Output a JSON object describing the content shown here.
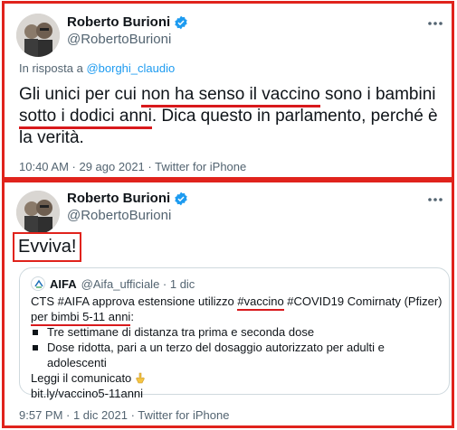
{
  "tweet1": {
    "author_name": "Roberto Burioni",
    "author_handle": "@RobertoBurioni",
    "reply_prefix": "In risposta a",
    "reply_mention": "@borghi_claudio",
    "text_a": "Gli unici per cui ",
    "text_b": "non ha senso il vaccino",
    "text_c": " sono i bambini ",
    "text_d": "sotto i dodici anni",
    "text_e": ". Dica questo in parlamento, perché è la verità.",
    "timestamp": "10:40 AM · 29 ago 2021 · Twitter for iPhone"
  },
  "tweet2": {
    "author_name": "Roberto Burioni",
    "author_handle": "@RobertoBurioni",
    "text": "Evviva!",
    "timestamp": "9:57 PM · 1 dic 2021 · Twitter for iPhone",
    "quote": {
      "name": "AIFA",
      "handle_date": "@Aifa_ufficiale · 1 dic",
      "line1_a": "CTS #AIFA approva estensione utilizzo ",
      "line1_b": "#vaccino",
      "line1_c": " #COVID19 Comirnaty (Pfizer)",
      "line2": "per bimbi 5-11 anni",
      "line2_after": ":",
      "bullet1": "Tre settimane di distanza tra prima e seconda dose",
      "bullet2": "Dose ridotta, pari a un terzo del dosaggio autorizzato per adulti e adolescenti",
      "line_read": "Leggi il comunicato",
      "link": "bit.ly/vaccino5-11anni"
    }
  },
  "colors": {
    "frame_red": "#e0231c",
    "underline_red": "#d8191c",
    "link_blue": "#1d9bf0",
    "secondary_text": "#536471"
  }
}
